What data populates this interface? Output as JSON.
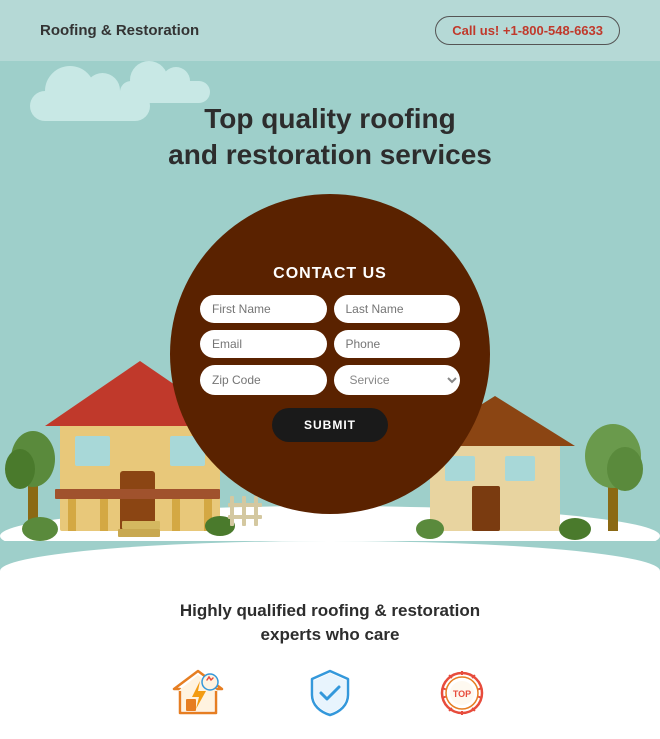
{
  "header": {
    "logo": "Roofing & Restoration",
    "call_label": "Call us!",
    "phone": "+1-800-548-6633"
  },
  "hero": {
    "title_line1": "Top quality roofing",
    "title_line2": "and restoration services"
  },
  "form": {
    "heading": "CONTACT US",
    "first_name_placeholder": "First Name",
    "last_name_placeholder": "Last Name",
    "email_placeholder": "Email",
    "phone_placeholder": "Phone",
    "zip_placeholder": "Zip Code",
    "service_placeholder": "Service",
    "submit_label": "SUBMIT"
  },
  "bottom": {
    "title_line1": "Highly qualified roofing & restoration",
    "title_line2": "experts who care"
  },
  "icons": [
    {
      "name": "house-lightning-icon",
      "label": ""
    },
    {
      "name": "shield-check-icon",
      "label": ""
    },
    {
      "name": "badge-icon",
      "label": ""
    }
  ]
}
